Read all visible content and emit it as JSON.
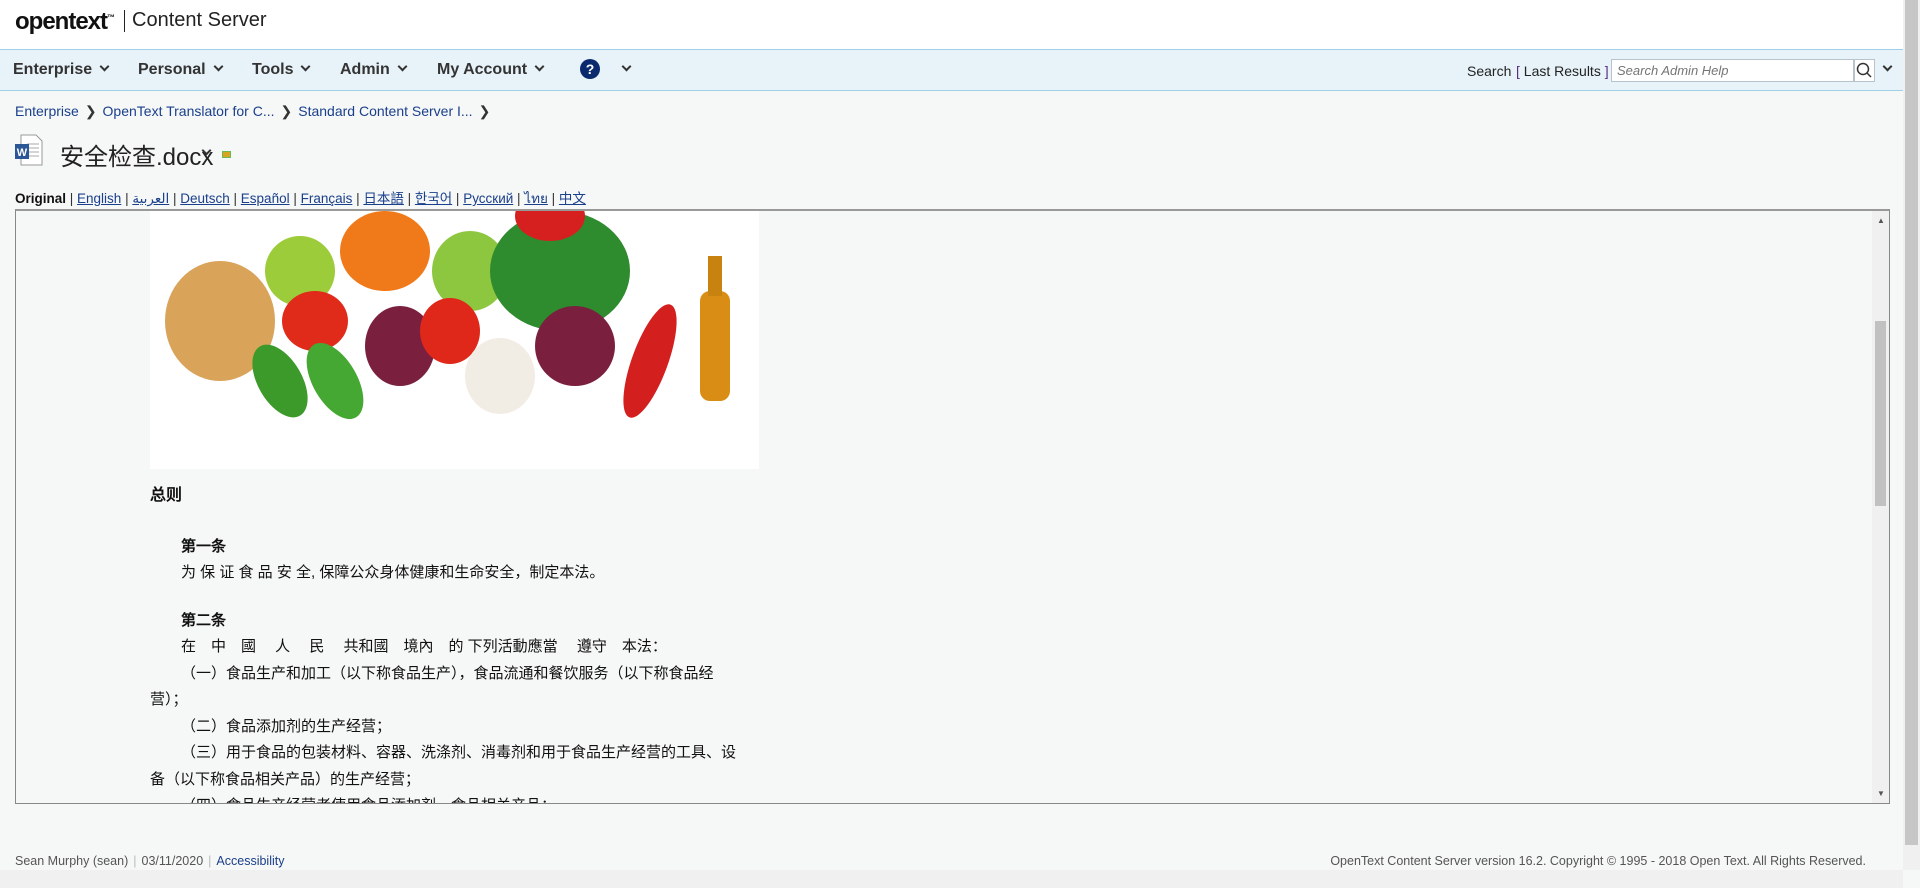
{
  "header": {
    "logo": "opentext",
    "logo_tm": "™",
    "product": "Content Server"
  },
  "nav": {
    "items": [
      {
        "label": "Enterprise"
      },
      {
        "label": "Personal"
      },
      {
        "label": "Tools"
      },
      {
        "label": "Admin"
      },
      {
        "label": "My Account"
      }
    ],
    "help_icon": "?",
    "search_label": "Search",
    "last_results": "Last Results",
    "search_placeholder": "Search Admin Help"
  },
  "breadcrumb": [
    "Enterprise",
    "OpenText Translator for C...",
    "Standard Content Server I..."
  ],
  "document": {
    "title": "安全检查.docx",
    "icon": "word-doc-icon"
  },
  "languages": {
    "current": "Original",
    "links": [
      "English",
      "العربية",
      "Deutsch",
      "Español",
      "Français",
      "日本語",
      "한국어",
      "Русский",
      "ไทย",
      "中文"
    ]
  },
  "content": {
    "heading": "总则",
    "article1_title": "第一条",
    "article1_text": "为 保 证 食 品 安 全, 保障公众身体健康和生命安全，制定本法。",
    "article2_title": "第二条",
    "article2_text": "在　中　國　 人　 民　 共和國　境內　的 下列活動應當　 遵守　本法：",
    "item1a": "（一）食品生产和加工（以下称食品生产），食品流通和餐饮服务（以下称食品经",
    "item1b": "营）；",
    "item2": "（二）食品添加剂的生产经营；",
    "item3a": "（三）用于食品的包装材料、容器、洗涤剂、消毒剂和用于食品生产经营的工具、设",
    "item3b": "备（以下称食品相关产品）的生产经营；",
    "item4": "（四）食品生产经营者使用食品添加剂、食品相关产品；"
  },
  "footer": {
    "user": "Sean Murphy (sean)",
    "date": "03/11/2020",
    "accessibility": "Accessibility",
    "copyright": "OpenText Content Server version 16.2. Copyright © 1995 - 2018 Open Text. All Rights Reserved."
  }
}
